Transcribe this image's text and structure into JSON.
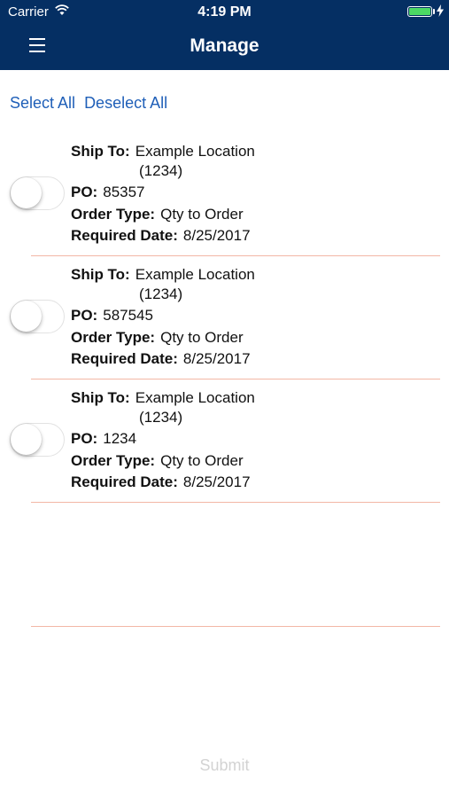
{
  "status_bar": {
    "carrier": "Carrier",
    "time": "4:19 PM",
    "battery_level": 1.0
  },
  "nav": {
    "title": "Manage",
    "menu_icon": "hamburger-menu-icon"
  },
  "actions": {
    "select_all": "Select All",
    "deselect_all": "Deselect All"
  },
  "labels": {
    "ship_to": "Ship To:",
    "po": "PO:",
    "order_type": "Order Type:",
    "required_date": "Required Date:"
  },
  "orders": [
    {
      "ship_to_line1": "Example Location",
      "ship_to_line2": "(1234)",
      "po": "85357",
      "order_type": "Qty to Order",
      "required_date": "8/25/2017",
      "selected": false
    },
    {
      "ship_to_line1": "Example Location",
      "ship_to_line2": "(1234)",
      "po": "587545",
      "order_type": "Qty to Order",
      "required_date": "8/25/2017",
      "selected": false
    },
    {
      "ship_to_line1": "Example Location",
      "ship_to_line2": "(1234)",
      "po": "1234",
      "order_type": "Qty to Order",
      "required_date": "8/25/2017",
      "selected": false
    }
  ],
  "submit_label": "Submit",
  "colors": {
    "header": "#052f63",
    "link": "#1f5fb8",
    "divider": "#f3b7a6",
    "submit_disabled": "#d3d3d3",
    "battery": "#4cd964"
  }
}
